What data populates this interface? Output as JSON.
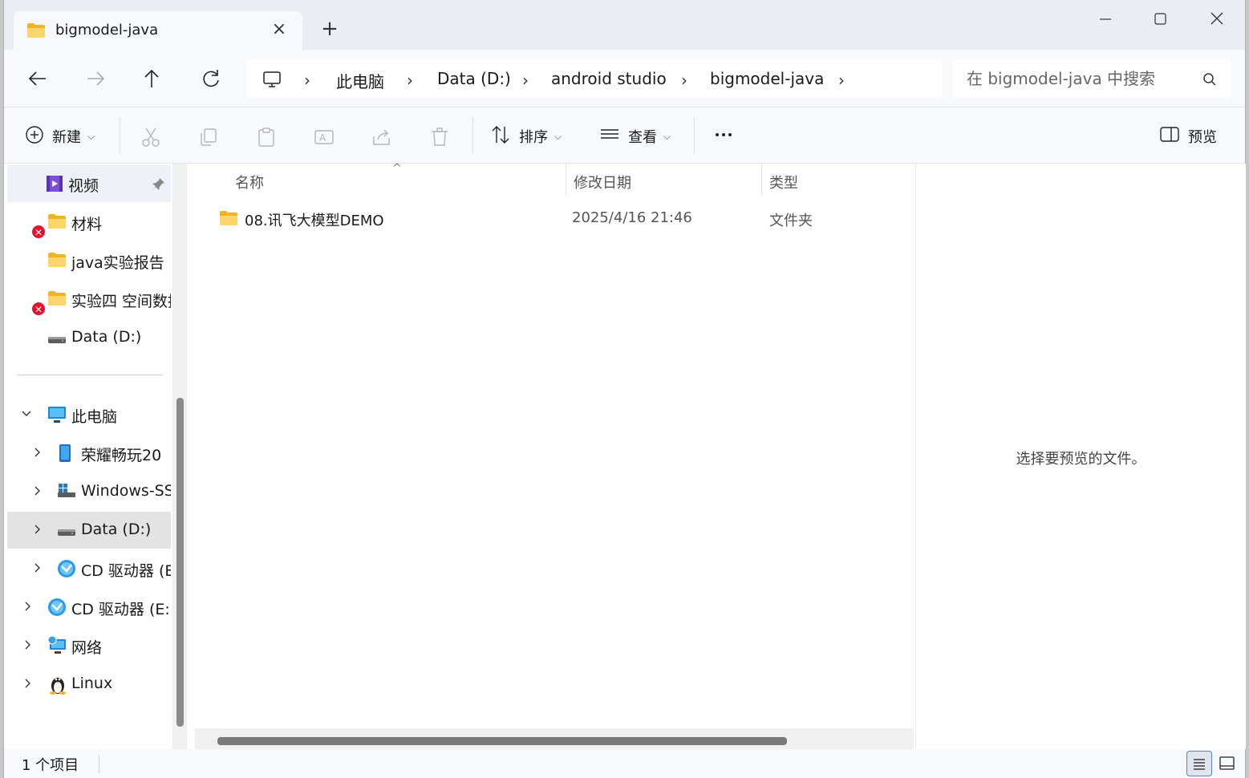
{
  "window": {
    "tab_title": "bigmodel-java"
  },
  "nav": {
    "breadcrumbs": [
      "此电脑",
      "Data (D:)",
      "android studio",
      "bigmodel-java"
    ],
    "search_placeholder": "在 bigmodel-java 中搜索"
  },
  "toolbar": {
    "new_label": "新建",
    "sort_label": "排序",
    "view_label": "查看",
    "preview_label": "预览"
  },
  "sidebar": {
    "items": [
      {
        "label": "视频",
        "icon": "video-icon"
      },
      {
        "label": "材料",
        "icon": "folder-icon",
        "badge": "error"
      },
      {
        "label": "java实验报告",
        "icon": "folder-icon"
      },
      {
        "label": "实验四 空间数据",
        "icon": "folder-icon",
        "badge": "error"
      },
      {
        "label": "Data (D:)",
        "icon": "drive-icon"
      },
      {
        "label": "此电脑",
        "icon": "pc-icon"
      },
      {
        "label": "荣耀畅玩20",
        "icon": "phone-icon"
      },
      {
        "label": "Windows-SSD",
        "icon": "windows-drive-icon"
      },
      {
        "label": "Data (D:)",
        "icon": "drive-icon"
      },
      {
        "label": "CD 驱动器 (E:)",
        "icon": "cd-drive-icon"
      },
      {
        "label": "CD 驱动器 (E:) H",
        "icon": "cd-drive-icon"
      },
      {
        "label": "网络",
        "icon": "network-icon"
      },
      {
        "label": "Linux",
        "icon": "linux-icon"
      }
    ]
  },
  "columns": {
    "name": "名称",
    "modified": "修改日期",
    "type": "类型"
  },
  "files": [
    {
      "name": "08.讯飞大模型DEMO",
      "modified": "2025/4/16 21:46",
      "type": "文件夹"
    }
  ],
  "preview": {
    "message": "选择要预览的文件。"
  },
  "status": {
    "item_count": "1 个项目"
  },
  "colors": {
    "folder": "#f5c242",
    "accent": "#0067c0",
    "error_badge": "#e8112d"
  }
}
